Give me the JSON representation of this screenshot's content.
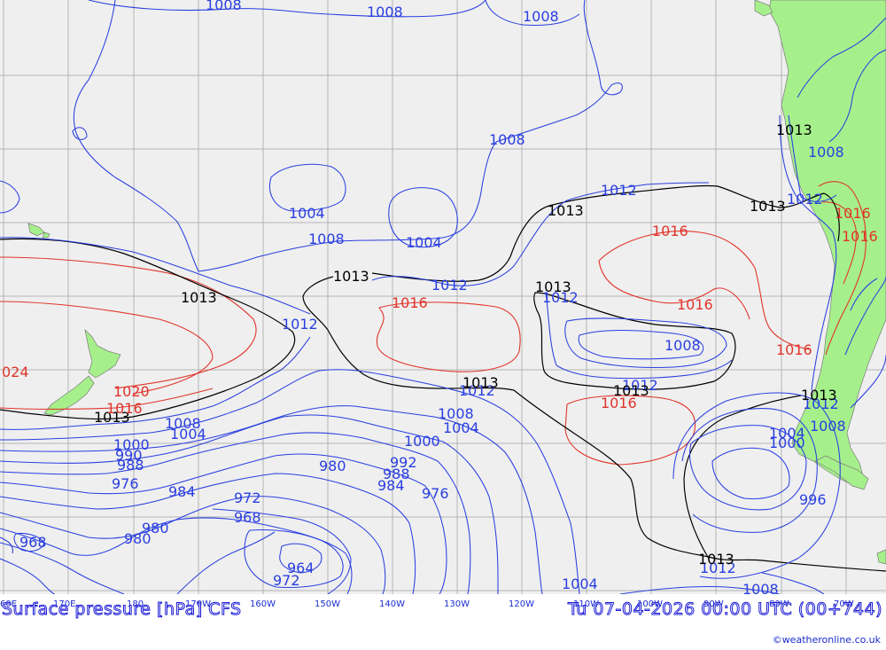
{
  "map": {
    "product_title": "Surface pressure [hPa] CFS",
    "run_time": "Tu 07-04-2026 00:00 UTC (00+744)",
    "credit": "©weatheronline.co.uk",
    "longitude_labels": [
      "60E",
      "170E",
      "180",
      "170W",
      "160W",
      "150W",
      "140W",
      "130W",
      "120W",
      "110W",
      "100W",
      "90W",
      "80W",
      "70W"
    ],
    "colors": {
      "ocean": "#efefef",
      "land": "#a6f08c",
      "isobar_low": "#2a3fe0",
      "isobar_mean": "#000000",
      "isobar_high": "#e0352a",
      "grid": "#b4b4b4"
    },
    "isobar_labels": {
      "blue": [
        "1008",
        "1008",
        "1008",
        "1008",
        "1004",
        "1008",
        "1004",
        "1012",
        "1012",
        "1012",
        "1008",
        "1012",
        "1012",
        "1012",
        "1008",
        "1004",
        "1008",
        "1000",
        "990",
        "988",
        "976",
        "984",
        "980",
        "980",
        "980",
        "972",
        "968",
        "964",
        "972",
        "1000",
        "992",
        "988",
        "984",
        "976",
        "968",
        "1004",
        "1012",
        "1008",
        "1004",
        "1000",
        "996",
        "1004",
        "1008",
        "1008",
        "1012",
        "1012"
      ],
      "black": [
        "1013",
        "1013",
        "1013",
        "1013",
        "1013",
        "1013",
        "1013",
        "1013",
        "1013",
        "1013"
      ],
      "red": [
        "1016",
        "1016",
        "1016",
        "1016",
        "1016",
        "1016",
        "1016",
        "1016",
        "1020",
        "1016",
        "024"
      ]
    }
  }
}
